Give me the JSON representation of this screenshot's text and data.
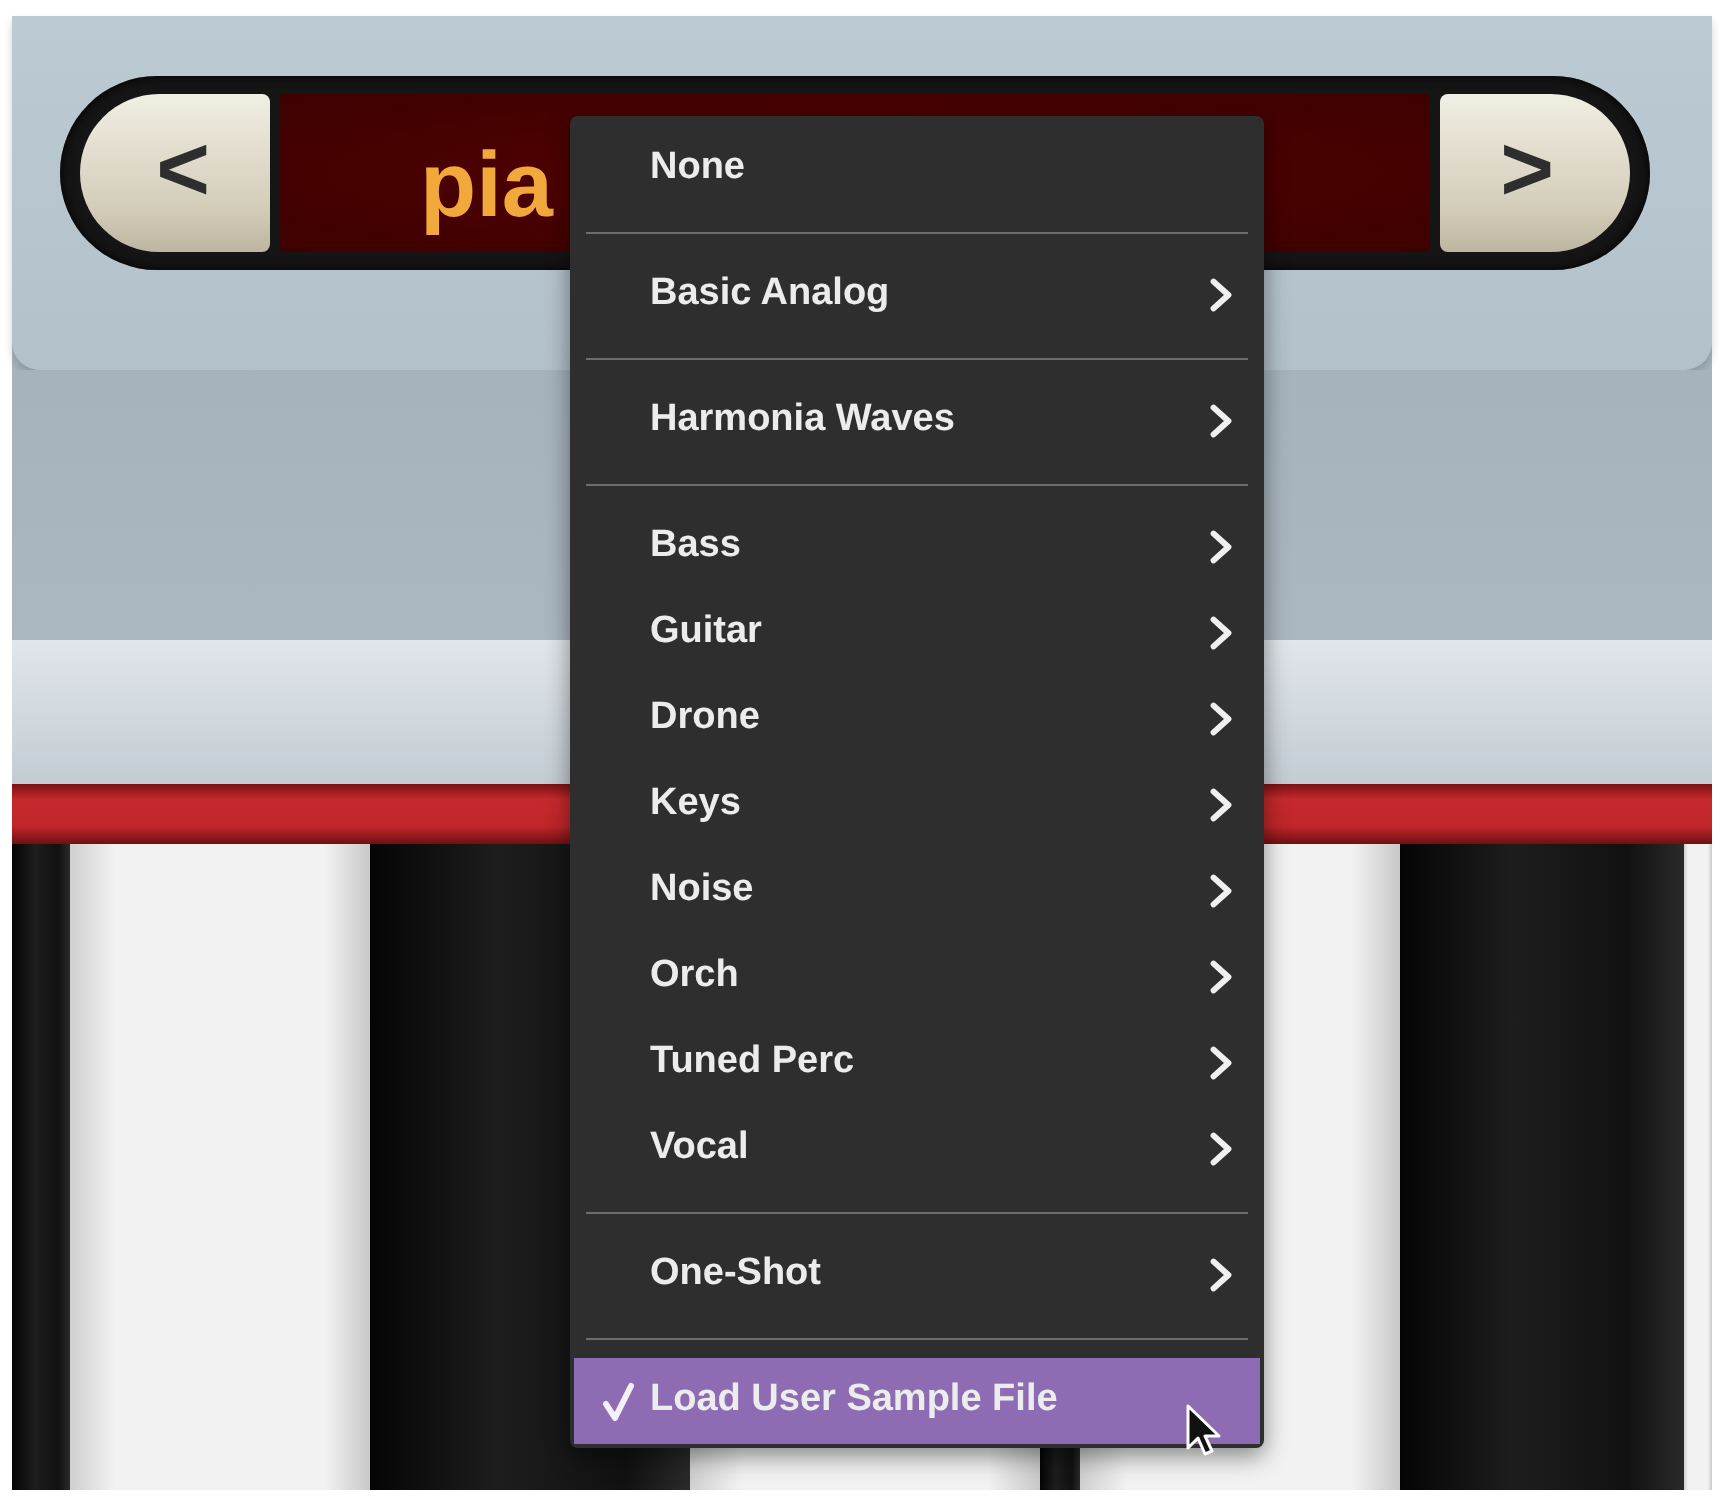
{
  "preset_selector": {
    "previous_button": "<",
    "preset_name": "pia",
    "next_button": ">"
  },
  "menu": {
    "groups": [
      {
        "items": [
          {
            "label": "None",
            "submenu": false,
            "checked": false,
            "selected": false
          }
        ]
      },
      {
        "items": [
          {
            "label": "Basic Analog",
            "submenu": true,
            "checked": false,
            "selected": false
          }
        ]
      },
      {
        "items": [
          {
            "label": "Harmonia Waves",
            "submenu": true,
            "checked": false,
            "selected": false
          }
        ]
      },
      {
        "items": [
          {
            "label": "Bass",
            "submenu": true,
            "checked": false,
            "selected": false
          },
          {
            "label": "Guitar",
            "submenu": true,
            "checked": false,
            "selected": false
          },
          {
            "label": "Drone",
            "submenu": true,
            "checked": false,
            "selected": false
          },
          {
            "label": "Keys",
            "submenu": true,
            "checked": false,
            "selected": false
          },
          {
            "label": "Noise",
            "submenu": true,
            "checked": false,
            "selected": false
          },
          {
            "label": "Orch",
            "submenu": true,
            "checked": false,
            "selected": false
          },
          {
            "label": "Tuned Perc",
            "submenu": true,
            "checked": false,
            "selected": false
          },
          {
            "label": "Vocal",
            "submenu": true,
            "checked": false,
            "selected": false
          }
        ]
      },
      {
        "items": [
          {
            "label": "One-Shot",
            "submenu": true,
            "checked": false,
            "selected": false
          }
        ]
      },
      {
        "items": [
          {
            "label": "Load User Sample File",
            "submenu": false,
            "checked": true,
            "selected": true
          }
        ]
      }
    ]
  }
}
